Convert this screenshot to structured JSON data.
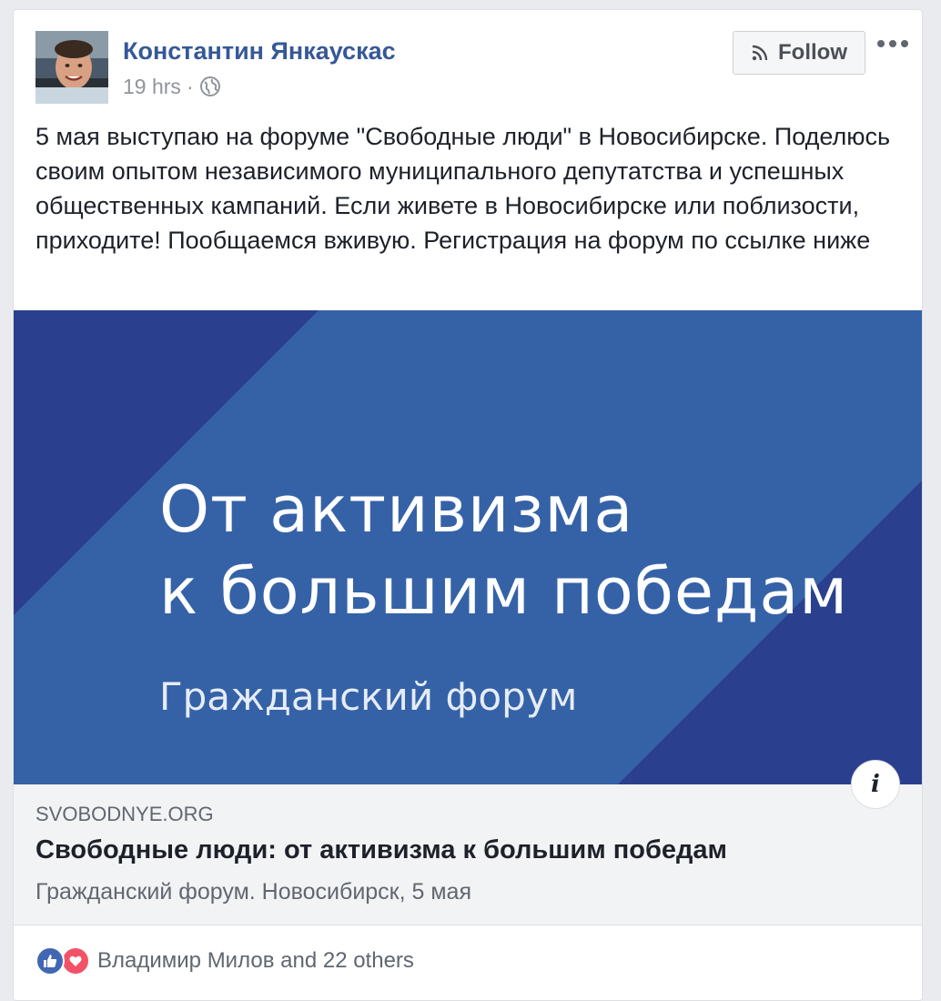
{
  "post": {
    "author": "Константин Янкаускас",
    "time": "19 hrs",
    "separator": "·",
    "privacy_icon": "globe-icon",
    "follow_label": "Follow",
    "follow_icon": "rss-icon",
    "more_icon": "more-dots-icon",
    "text": "5 мая выступаю на форуме \"Свободные люди\" в Новосибирске. Поделюсь своим опытом независимого муниципального депутатства и успешных общественных кампаний. Если живете в Новосибирске или поблизости, приходите! Пообщаемся вживую. Регистрация на форум по ссылке ниже"
  },
  "link_preview": {
    "image": {
      "line1": "От активизма",
      "line2": "к большим победам",
      "subtitle": "Гражданский форум",
      "colors": {
        "main": "#3562a7",
        "dark": "#2b3f8f"
      }
    },
    "info_label": "i",
    "domain": "SVOBODNYE.ORG",
    "title": "Свободные люди: от активизма к большим победам",
    "description": "Гражданский форум. Новосибирск, 5 мая"
  },
  "reactions": {
    "icons": [
      "like-icon",
      "love-icon"
    ],
    "text": "Владимир Милов and 22 others"
  },
  "colors": {
    "link_blue": "#365899",
    "like_blue": "#4267b2",
    "love_red": "#f25268"
  }
}
